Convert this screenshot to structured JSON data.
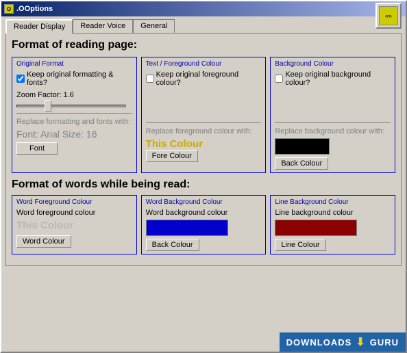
{
  "window": {
    "title": ".OOptions",
    "logo_text": "«»"
  },
  "tabs": [
    {
      "label": "Reader Display",
      "active": true
    },
    {
      "label": "Reader Voice",
      "active": false
    },
    {
      "label": "General",
      "active": false
    }
  ],
  "section1": {
    "title": "Format of reading page:",
    "original_format": {
      "label": "Original Format",
      "checkbox_label": "Keep original formatting & fonts?",
      "checked": true,
      "zoom_label": "Zoom Factor: 1.6",
      "replace_label": "Replace formatting and fonts with:",
      "font_preview": "Font: Arial    Size: 16"
    },
    "text_foreground": {
      "label": "Text / Foreground Colour",
      "checkbox_label": "Keep original foreground colour?",
      "checked": false,
      "replace_label": "Replace foreground colour with:",
      "colour_text": "This Colour",
      "button_label": "Fore Colour"
    },
    "background": {
      "label": "Background Colour",
      "checkbox_label": "Keep original background colour?",
      "checked": false,
      "replace_label": "Replace background colour with:",
      "button_label": "Back Colour"
    }
  },
  "section2": {
    "title": "Format of words while being read:",
    "word_foreground": {
      "label": "Word Foreground Colour",
      "text": "Word foreground colour",
      "colour_text": "This Colour",
      "button_label": "Word Colour"
    },
    "word_background": {
      "label": "Word Background Colour",
      "text": "Word background colour",
      "button_label": "Back Colour"
    },
    "line_background": {
      "label": "Line Background Colour",
      "text": "Line background colour",
      "button_label": "Line Colour"
    }
  },
  "watermark": {
    "text": "DOWNLOADS",
    "suffix": "GURU"
  }
}
